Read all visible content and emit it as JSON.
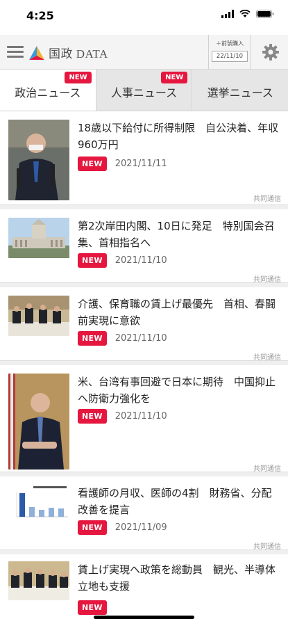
{
  "status_bar": {
    "time": "4:25"
  },
  "header": {
    "logo_text": "国政 DATA",
    "edition_label": "＋前號購入",
    "edition_date": "22/11/10"
  },
  "tabs": [
    {
      "label": "政治ニュース",
      "badge": "NEW"
    },
    {
      "label": "人事ニュース",
      "badge": "NEW"
    },
    {
      "label": "選挙ニュース"
    }
  ],
  "news": [
    {
      "title": "18歳以下給付に所得制限　自公決着、年収960万円",
      "badge": "NEW",
      "date": "2021/11/11",
      "source": "共同通信"
    },
    {
      "title": "第2次岸田内閣、10日に発足　特別国会召集、首相指名へ",
      "badge": "NEW",
      "date": "2021/11/10",
      "source": "共同通信"
    },
    {
      "title": "介護、保育職の賃上げ最優先　首相、春闘前実現に意欲",
      "badge": "NEW",
      "date": "2021/11/10",
      "source": "共同通信"
    },
    {
      "title": "米、台湾有事回避で日本に期待　中国抑止へ防衛力強化を",
      "badge": "NEW",
      "date": "2021/11/10",
      "source": "共同通信"
    },
    {
      "title": "看護師の月収、医師の4割　財務省、分配改善を提言",
      "badge": "NEW",
      "date": "2021/11/09",
      "source": "共同通信"
    },
    {
      "title": "賃上げ実現へ政策を総動員　観光、半導体立地も支援",
      "badge": "NEW",
      "date": ""
    }
  ],
  "colors": {
    "accent": "#e5173f",
    "tab_bg": "#e6e6e6",
    "header_bg": "#f4f4f4"
  },
  "icons": [
    "menu-icon",
    "gear-icon",
    "signal-icon",
    "wifi-icon",
    "battery-icon"
  ]
}
